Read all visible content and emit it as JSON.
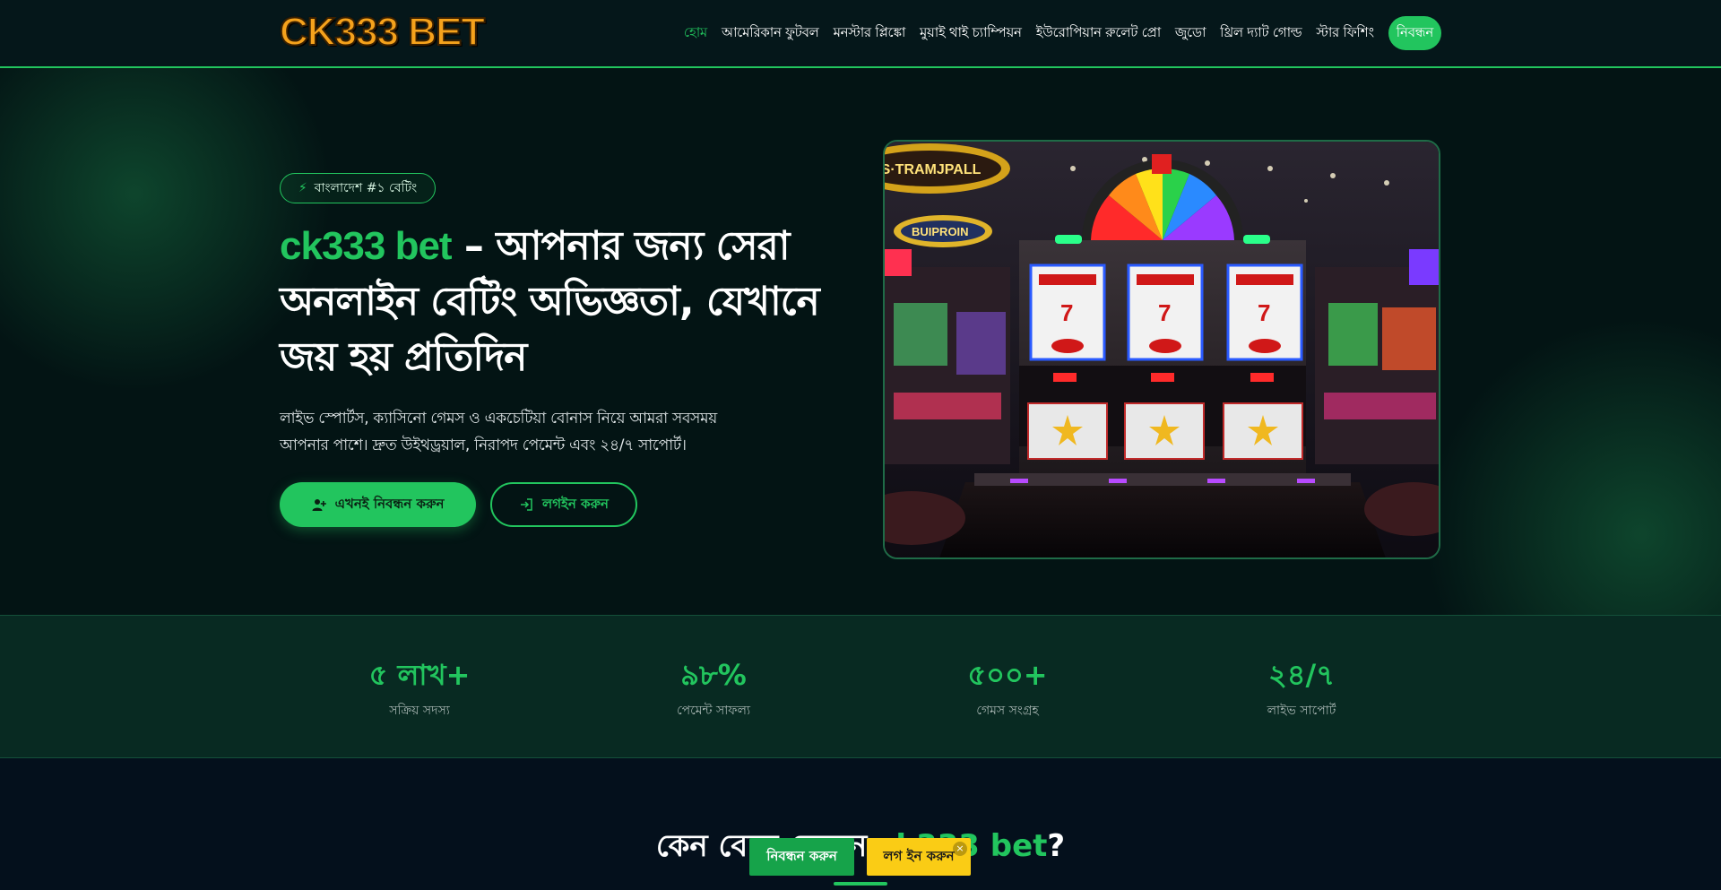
{
  "header": {
    "logo_text": "CK333 BET",
    "nav": [
      {
        "label": "হোম",
        "active": true
      },
      {
        "label": "আমেরিকান ফুটবল",
        "active": false
      },
      {
        "label": "মনস্টার প্লিঙ্কো",
        "active": false
      },
      {
        "label": "মুয়াই থাই চ্যাম্পিয়ন",
        "active": false
      },
      {
        "label": "ইউরোপিয়ান রুলেট প্রো",
        "active": false
      },
      {
        "label": "জুডো",
        "active": false
      },
      {
        "label": "থ্রিল দ্যাট গোল্ড",
        "active": false
      },
      {
        "label": "স্টার ফিশিং",
        "active": false
      }
    ],
    "register_label": "নিবন্ধন"
  },
  "hero": {
    "badge": "বাংলাদেশ #১ বেটিং",
    "title_brand": "ck333 bet",
    "title_rest": " – আপনার জন্য সেরা অনলাইন বেটিং অভিজ্ঞতা, যেখানে জয় হয় প্রতিদিন",
    "description": "লাইভ স্পোর্টস, ক্যাসিনো গেমস ও একচেটিয়া বোনাস নিয়ে আমরা সবসময় আপনার পাশে। দ্রুত উইথড্রয়াল, নিরাপদ পেমেন্ট এবং ২৪/৭ সাপোর্ট।",
    "primary_button": "এখনই নিবন্ধন করুন",
    "secondary_button": "লগইন করুন",
    "image_sign_1": "ES·TRAMJPALL",
    "image_sign_2": "BUIPROIN"
  },
  "stats": [
    {
      "value": "৫ লাখ+",
      "label": "সক্রিয় সদস্য"
    },
    {
      "value": "৯৮%",
      "label": "পেমেন্ট সাফল্য"
    },
    {
      "value": "৫০০+",
      "label": "গেমস সংগ্রহ"
    },
    {
      "value": "২৪/৭",
      "label": "লাইভ সাপোর্ট"
    }
  ],
  "why": {
    "title_prefix": "কেন বেছে নেবেন ",
    "title_brand": "ck333 bet",
    "title_suffix": "?"
  },
  "floating": {
    "register_label": "নিবন্ধন করুন",
    "login_label": "লগ ইন করুন",
    "close_symbol": "×"
  },
  "colors": {
    "accent": "#22c55e",
    "logo": "#f5a21c",
    "login_yellow": "#facc15",
    "background": "#04121a"
  }
}
